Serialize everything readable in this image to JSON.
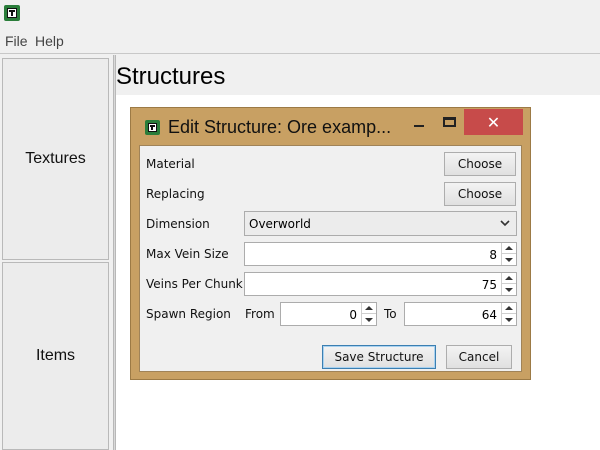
{
  "window": {
    "icon": "app-icon"
  },
  "menu": {
    "file": "File",
    "help": "Help"
  },
  "sidebar": {
    "textures": "Textures",
    "items": "Items"
  },
  "page": {
    "title": "Structures"
  },
  "dialog": {
    "title": "Edit Structure: Ore examp...",
    "close_glyph": "✕",
    "material_label": "Material",
    "material_button": "Choose",
    "replacing_label": "Replacing",
    "replacing_button": "Choose",
    "dimension_label": "Dimension",
    "dimension_value": "Overworld",
    "max_vein_size_label": "Max Vein Size",
    "max_vein_size_value": "8",
    "veins_per_chunk_label": "Veins Per Chunk",
    "veins_per_chunk_value": "75",
    "spawn_region_label": "Spawn Region",
    "from_label": "From",
    "from_value": "0",
    "to_label": "To",
    "to_value": "64",
    "save_button": "Save Structure",
    "cancel_button": "Cancel"
  },
  "colors": {
    "dialog_frame": "#c8a063",
    "close_button": "#c74b4a",
    "icon_green": "#2a7d3a",
    "default_button_border": "#3c7fb1"
  }
}
